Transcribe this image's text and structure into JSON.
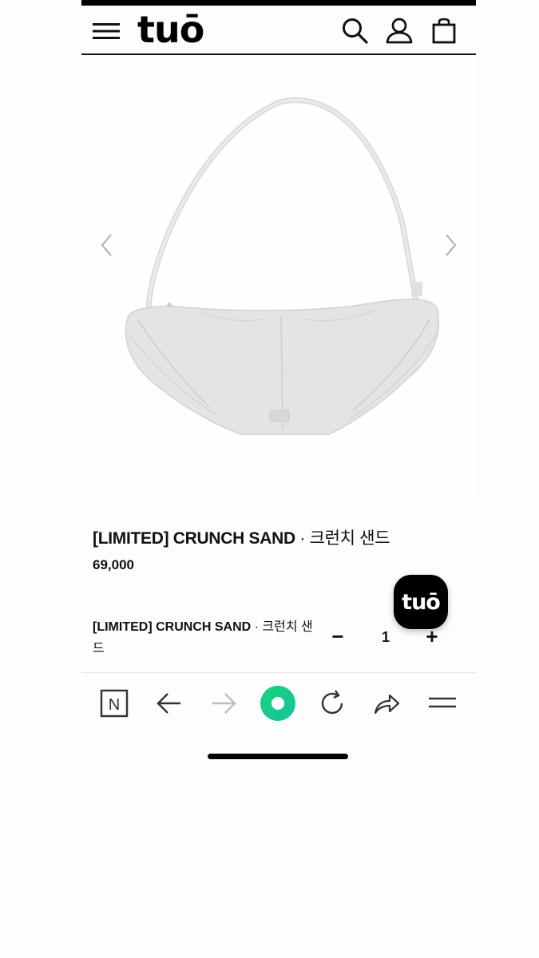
{
  "header": {
    "logo": "tuō",
    "icons": [
      "menu-icon",
      "search-icon",
      "user-icon",
      "shopping-bag-icon"
    ]
  },
  "product": {
    "image": "product-image-crunch-sand-bag",
    "title_en": "[LIMITED] CRUNCH SAND",
    "title_sep": " · ",
    "title_kr": "크런치 샌드",
    "price": "69,000"
  },
  "option": {
    "name_en": "[LIMITED] CRUNCH SAND",
    "name_sep": " · ",
    "name_kr": "크런치 샌드",
    "minus": "−",
    "quantity": "1",
    "plus": "+"
  },
  "floating_button": {
    "label": "tuō"
  },
  "browser_bar": {
    "icons": [
      "naver-n-icon",
      "back-arrow-icon",
      "forward-arrow-icon",
      "green-circle-icon",
      "refresh-icon",
      "share-icon",
      "hamburger-icon"
    ],
    "n_label": "N"
  },
  "colors": {
    "accent_green": "#1ec96b",
    "bag": "#e6e4e2"
  }
}
